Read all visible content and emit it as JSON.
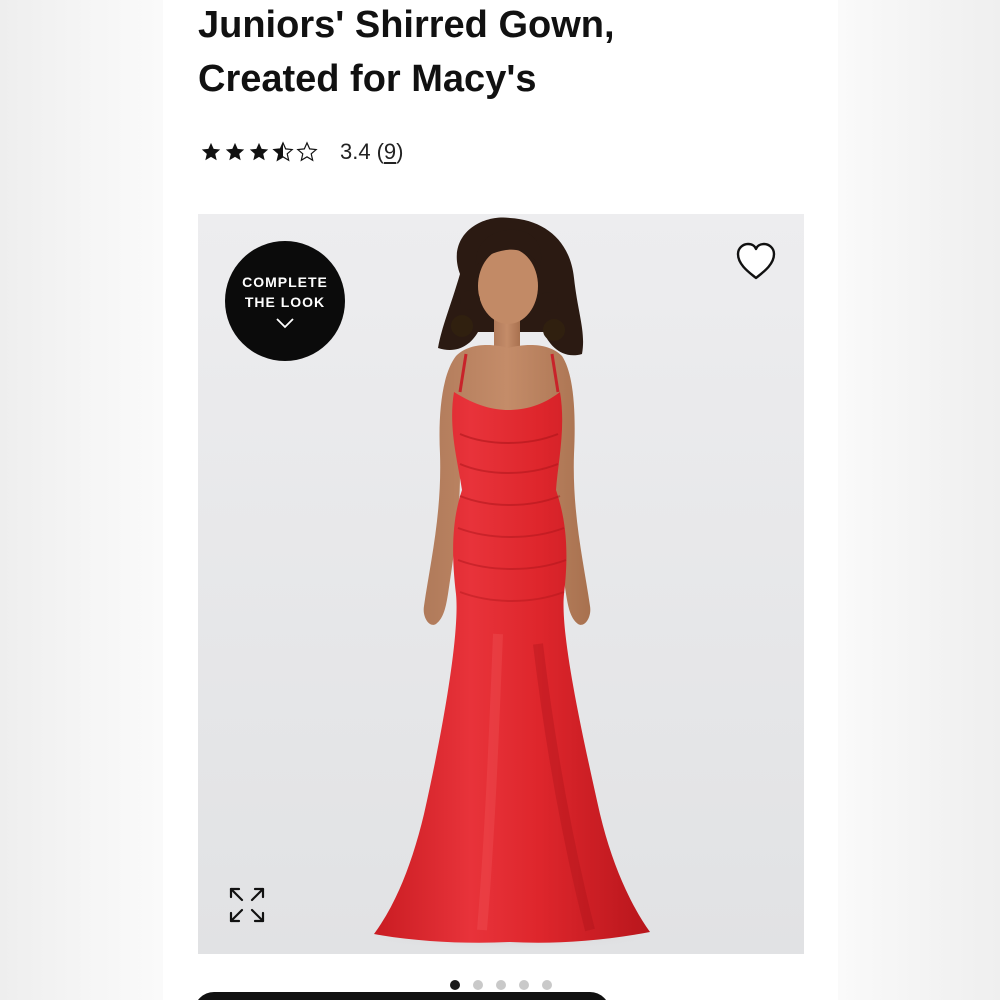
{
  "product": {
    "title_line1": "Juniors' Shirred Gown,",
    "title_line2": "Created for Macy's",
    "rating": {
      "stars": 3.4,
      "value_text": "3.4",
      "count_open": "(",
      "count": "9",
      "count_close": ")"
    }
  },
  "gallery": {
    "badge_line1": "COMPLETE",
    "badge_line2": "THE LOOK",
    "badge_icon": "chevron-down-icon",
    "favorite_icon": "heart-outline-icon",
    "expand_icon": "expand-arrows-icon",
    "slide_count": 5,
    "active_slide": 1
  },
  "colors": {
    "text": "#111111",
    "badge": "#0b0b0b",
    "dress": "#e0262b",
    "dot_active": "#1a1a1a",
    "dot_inactive": "#c9c9c9"
  }
}
